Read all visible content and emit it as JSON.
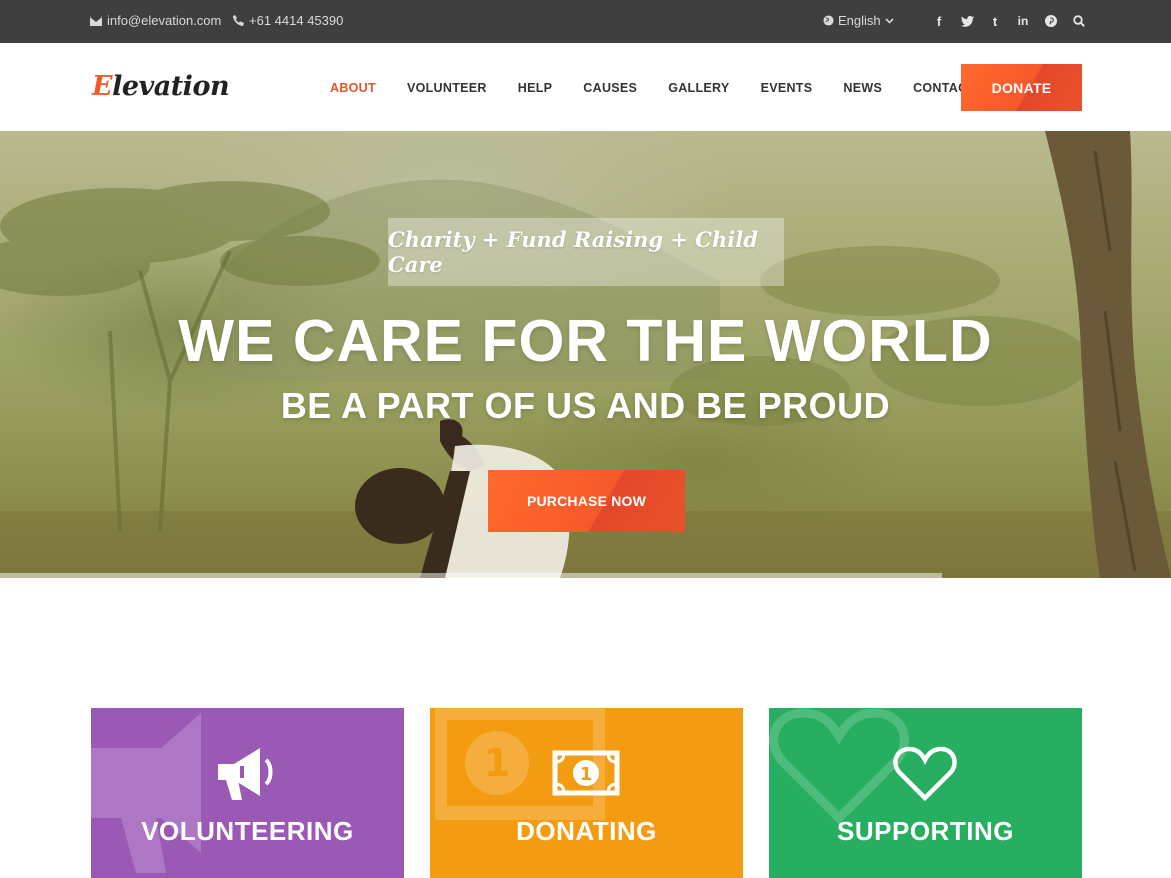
{
  "topbar": {
    "email": "info@elevation.com",
    "phone": "+61 4414 45390",
    "language": "English",
    "social": [
      {
        "name": "facebook-icon",
        "glyph": "f"
      },
      {
        "name": "twitter-icon",
        "glyph": "t"
      },
      {
        "name": "tumblr-icon",
        "glyph": "t"
      },
      {
        "name": "linkedin-icon",
        "glyph": "in"
      },
      {
        "name": "pinterest-icon",
        "glyph": "p"
      },
      {
        "name": "search-icon",
        "glyph": ""
      }
    ]
  },
  "header": {
    "logo_first": "E",
    "logo_rest": "levation",
    "nav": [
      "ABOUT",
      "VOLUNTEER",
      "HELP",
      "CAUSES",
      "GALLERY",
      "EVENTS",
      "NEWS",
      "CONTACT"
    ],
    "active_nav": "ABOUT",
    "donate_label": "DONATE"
  },
  "hero": {
    "tagline": "Charity + Fund Raising + Child Care",
    "title": "WE CARE FOR THE WORLD",
    "subtitle": "BE A PART OF US AND BE PROUD",
    "cta_label": "PURCHASE NOW"
  },
  "cards": [
    {
      "label": "VOLUNTEERING",
      "icon": "megaphone-icon",
      "color": "#9b59b6"
    },
    {
      "label": "DONATING",
      "icon": "money-icon",
      "color": "#f39c12"
    },
    {
      "label": "SUPPORTING",
      "icon": "heart-icon",
      "color": "#27ae60"
    }
  ],
  "colors": {
    "accent": "#f05a28",
    "topbar": "#3f3f3f"
  }
}
